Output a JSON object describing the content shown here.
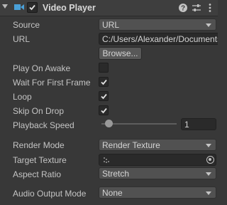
{
  "header": {
    "title": "Video Player",
    "enabled": true
  },
  "fields": {
    "source": {
      "label": "Source",
      "value": "URL"
    },
    "url": {
      "label": "URL",
      "value": "C:/Users/Alexander/Documents"
    },
    "browse_label": "Browse...",
    "play_on_awake": {
      "label": "Play On Awake",
      "checked": false
    },
    "wait_for_first_frame": {
      "label": "Wait For First Frame",
      "checked": true
    },
    "loop": {
      "label": "Loop",
      "checked": true
    },
    "skip_on_drop": {
      "label": "Skip On Drop",
      "checked": true
    },
    "playback_speed": {
      "label": "Playback Speed",
      "value": "1"
    },
    "render_mode": {
      "label": "Render Mode",
      "value": "Render Texture"
    },
    "target_texture": {
      "label": "Target Texture",
      "value": ""
    },
    "aspect_ratio": {
      "label": "Aspect Ratio",
      "value": "Stretch"
    },
    "audio_output_mode": {
      "label": "Audio Output Mode",
      "value": "None"
    }
  },
  "icons": {
    "component": "video-player-icon",
    "help": "help-icon",
    "presets": "presets-icon",
    "menu": "context-menu-icon",
    "texture": "texture-icon",
    "picker": "object-picker-icon"
  }
}
